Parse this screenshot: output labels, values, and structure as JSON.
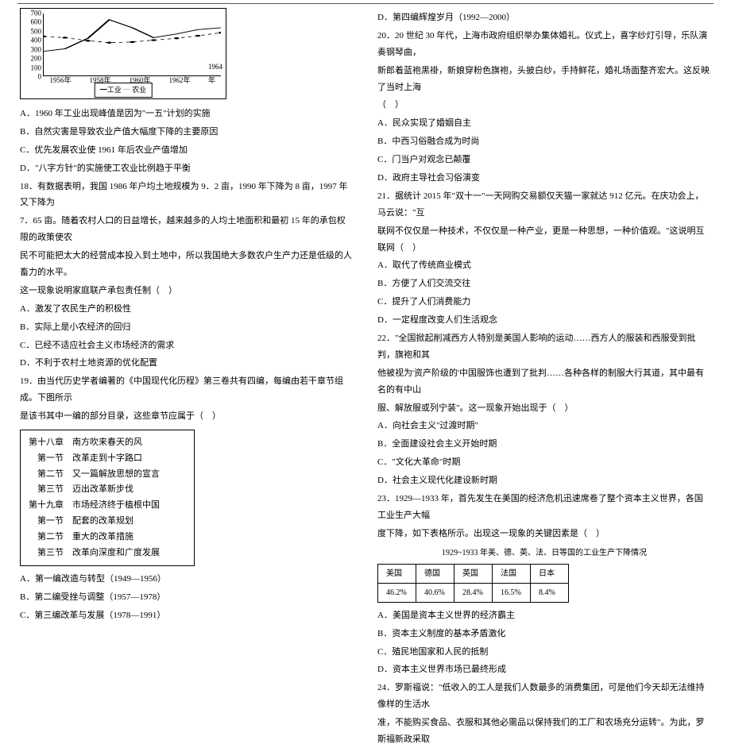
{
  "chart_data": {
    "type": "line",
    "categories": [
      "1956年",
      "1958年",
      "1960年",
      "1962年",
      "1964年"
    ],
    "series": [
      {
        "name": "工业",
        "values": [
          270,
          300,
          420,
          630,
          540,
          430,
          470,
          520,
          540
        ]
      },
      {
        "name": "农业",
        "values": [
          440,
          430,
          390,
          370,
          380,
          400,
          420,
          450,
          480
        ]
      }
    ],
    "ylim": [
      0,
      700
    ],
    "yticks": [
      0,
      100,
      200,
      300,
      400,
      500,
      600,
      700
    ],
    "legend": "━工业 ┄ 农业"
  },
  "left": {
    "q17": {
      "opts": {
        "A": "A．1960 年工业出现峰值是因为\"一五\"计划的实施",
        "B": "B．自然灾害是导致农业产值大幅度下降的主要原因",
        "C": "C．优先发展农业使 1961 年后农业产值增加",
        "D": "D．\"八字方针\"的实施使工农业比例趋于平衡"
      }
    },
    "q18": {
      "stem1": "18．有数据表明，我国 1986 年户均土地规模为 9．2 亩，1990 年下降为 8 亩，1997 年又下降为",
      "stem2": "7．65 亩。随着农村人口的日益增长，越来越多的人均土地面积和最初 15 年的承包权限的政策使农",
      "stem3": "民不可能把太大的经营成本投入到土地中，所以我国绝大多数农户生产力还是低级的人畜力的水平。",
      "stem4": "这一现象说明家庭联产承包责任制（　）",
      "opts": {
        "A": "A．激发了农民生产的积极性",
        "B": "B．实际上是小农经济的回归",
        "C": "C．已经不适应社会主义市场经济的需求",
        "D": "D．不利于农村土地资源的优化配置"
      }
    },
    "q19": {
      "stem1": "19．由当代历史学者编著的《中国现代化历程》第三卷共有四编，每编由若干章节组成。下图所示",
      "stem2": "是该书其中一编的部分目录，这些章节应属于（　）",
      "toc": [
        "第十八章　南方吹来春天的风",
        "　第一节　改革走到十字路口",
        "　第二节　又一篇解放思想的宣言",
        "　第三节　迈出改革新步伐",
        "第十九章　市场经济终于植根中国",
        "　第一节　配套的改革规划",
        "　第二节　重大的改革措施",
        "　第三节　改革向深度和广度发展"
      ],
      "opts": {
        "A": "A．第一编改造与转型（1949—1956）",
        "B": "B．第二编受挫与调整（1957—1978）",
        "C": "C．第三编改革与发展（1978—1991）"
      }
    }
  },
  "right": {
    "q19D": "D．第四编辉煌岁月（1992—2000）",
    "q20": {
      "stem1": "20．20 世纪 30 年代，上海市政府组织举办集体婚礼。仪式上，喜字纱灯引导，乐队演奏钢琴曲，",
      "stem2": "新郎着蓝袍黑褂，新娘穿粉色旗袍，头披白纱，手持鲜花，婚礼场面整齐宏大。这反映了当时上海",
      "stem3": "（　）",
      "opts": {
        "A": "A．民众实现了婚姻自主",
        "B": "B．中西习俗融合成为时尚",
        "C": "C．门当户对观念已颠覆",
        "D": "D．政府主导社会习俗演变"
      }
    },
    "q21": {
      "stem1": "21．据统计 2015 年\"双十一\"一天网购交易额仅天猫一家就达 912 亿元。在庆功会上，马云说：\"互",
      "stem2": "联网不仅仅是一种技术，不仅仅是一种产业，更是一种思想，一种价值观。\"这说明互联网（　）",
      "opts": {
        "A": "A．取代了传统商业模式",
        "B": "B．方便了人们交流交往",
        "C": "C．提升了人们消费能力",
        "D": "D．一定程度改变人们生活观念"
      }
    },
    "q22": {
      "stem1": "22．\"全国掀起削减西方人特别是美国人影响的运动……西方人的服装和西服受到批判，旗袍和其",
      "stem2": "他被视为'资产阶级的'中国服饰也遭到了批判……各种各样的制服大行其道，其中最有名的有中山",
      "stem3": "服、解放服或列宁装\"。这一现象开始出现于（　）",
      "opts": {
        "A": "A．向社会主义\"过渡时期\"",
        "B": "B．全面建设社会主义开始时期",
        "C": "C．\"文化大革命\"时期",
        "D": "D．社会主义现代化建设新时期"
      }
    },
    "q23": {
      "stem1": "23．1929—1933 年，首先发生在美国的经济危机迅速席卷了整个资本主义世界，各国工业生产大幅",
      "stem2": "度下降，如下表格所示。出现这一现象的关键因素是（　）",
      "tabletitle": "1929~1933 年美、德、英、法、日等国的工业生产下降情况",
      "headers": [
        "美国",
        "德国",
        "英国",
        "法国",
        "日本"
      ],
      "values": [
        "46.2%",
        "40.6%",
        "28.4%",
        "16.5%",
        "8.4%"
      ],
      "opts": {
        "A": "A．美国是资本主义世界的经济霸主",
        "B": "B．资本主义制度的基本矛盾激化",
        "C": "C．殖民地国家和人民的抵制",
        "D": "D．资本主义世界市场已最终形成"
      }
    },
    "q24": {
      "stem1": "24．罗斯福说：\"低收入的工人是我们人数最多的消费集团，可是他们今天却无法维持像样的生活水",
      "stem2": "准，不能购买食品、衣服和其他必需品以保持我们的工厂和农场充分运转\"。为此，罗斯福新政采取"
    }
  }
}
